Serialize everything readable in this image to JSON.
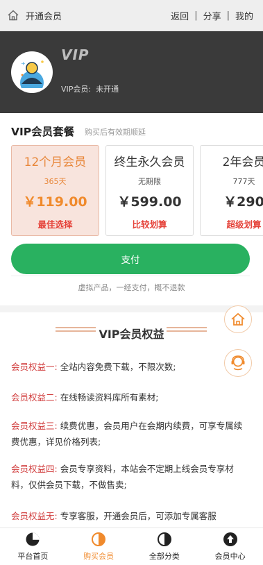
{
  "topbar": {
    "title": "开通会员",
    "links": [
      "返回",
      "分享",
      "我的"
    ]
  },
  "header": {
    "logo": "VIP",
    "status_label": "VIP会员:",
    "status_value": "未开通"
  },
  "packages": {
    "title": "VIP会员套餐",
    "subtitle": "购买后有效期顺延",
    "plans": [
      {
        "name": "12个月会员",
        "duration": "365天",
        "price": "￥119.00",
        "tag": "最佳选择",
        "selected": true
      },
      {
        "name": "终生永久会员",
        "duration": "无期限",
        "price": "￥599.00",
        "tag": "比较划算",
        "selected": false
      },
      {
        "name": "2年会员",
        "duration": "777天",
        "price": "￥290",
        "tag": "超级划算",
        "selected": false
      }
    ],
    "pay_button": "支付",
    "note": "虚拟产品，一经支付，概不退款"
  },
  "benefits": {
    "title": "VIP会员权益",
    "items": [
      {
        "key": "会员权益一:",
        "text": "全站内容免费下载，不限次数;"
      },
      {
        "key": "会员权益二:",
        "text": "在线畅读资料库所有素材;"
      },
      {
        "key": "会员权益三:",
        "text": "续费优惠，会员用户在会期内续费，可享专属续费优惠，详见价格列表;"
      },
      {
        "key": "会员权益四:",
        "text": "会员专享资料，本站会不定期上线会员专享材料，仅供会员下载，不做售卖;"
      },
      {
        "key": "会员权益无:",
        "text": "专享客服，开通会员后，可添加专属客服"
      }
    ]
  },
  "tabbar": {
    "items": [
      {
        "label": "平台首页",
        "icon": "pie-chart-icon",
        "active": false
      },
      {
        "label": "购买会员",
        "icon": "half-circle-icon",
        "active": true
      },
      {
        "label": "全部分类",
        "icon": "half-circle-icon",
        "active": false
      },
      {
        "label": "会员中心",
        "icon": "arrow-up-circle-icon",
        "active": false
      }
    ]
  },
  "colors": {
    "accent": "#f08a2c",
    "pay_green": "#29b160",
    "benefit_key": "#d13d3d",
    "header_bg": "#3a3a3a"
  }
}
